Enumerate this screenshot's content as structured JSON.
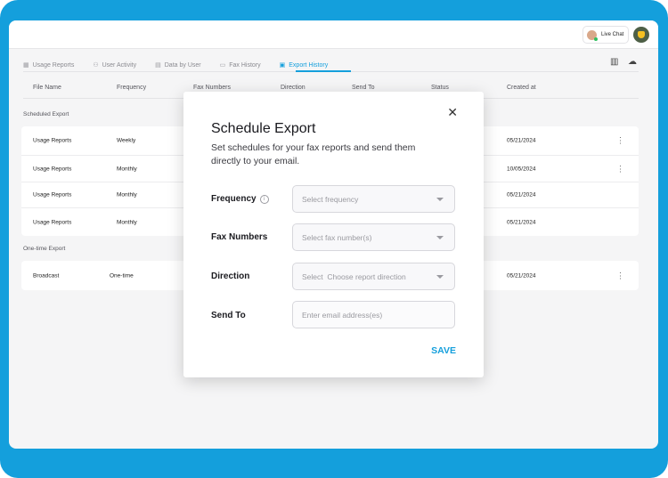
{
  "header": {
    "live_chat_label": "Live Chat"
  },
  "tabs": [
    {
      "label": "Usage Reports",
      "icon": "report-icon"
    },
    {
      "label": "User Activity",
      "icon": "user-activity-icon"
    },
    {
      "label": "Data by User",
      "icon": "data-by-user-icon"
    },
    {
      "label": "Fax History",
      "icon": "fax-history-icon"
    },
    {
      "label": "Export History",
      "icon": "export-history-icon",
      "active": true
    }
  ],
  "table": {
    "columns": [
      "File Name",
      "Frequency",
      "Fax Numbers",
      "Direction",
      "Send To",
      "Status",
      "Created at"
    ],
    "scheduled_label": "Scheduled Export",
    "scheduled_rows": [
      {
        "file_name": "Usage Reports",
        "frequency": "Weekly",
        "created_at": "05/21/2024",
        "has_menu": true
      },
      {
        "file_name": "Usage Reports",
        "frequency": "Monthly",
        "created_at": "10/05/2024",
        "has_menu": true
      },
      {
        "file_name": "Usage Reports",
        "frequency": "Monthly",
        "created_at": "05/21/2024",
        "has_menu": false
      },
      {
        "file_name": "Usage Reports",
        "frequency": "Monthly",
        "created_at": "05/21/2024",
        "has_menu": false
      }
    ],
    "onetime_label": "One-time Export",
    "onetime_rows": [
      {
        "file_name": "Broadcast",
        "frequency": "One-time",
        "created_at": "05/21/2024",
        "has_menu": true
      }
    ]
  },
  "modal": {
    "title": "Schedule Export",
    "description": "Set schedules for your fax reports and send them directly to your email.",
    "frequency_label": "Frequency",
    "frequency_placeholder": "Select frequency",
    "fax_numbers_label": "Fax Numbers",
    "fax_numbers_placeholder": "Select fax number(s)",
    "direction_label": "Direction",
    "direction_placeholder": "Select  Choose report direction",
    "send_to_label": "Send To",
    "send_to_placeholder": "Enter email address(es)",
    "save_label": "SAVE"
  },
  "colors": {
    "brand": "#149fdc",
    "background": "#f5f5f6"
  }
}
